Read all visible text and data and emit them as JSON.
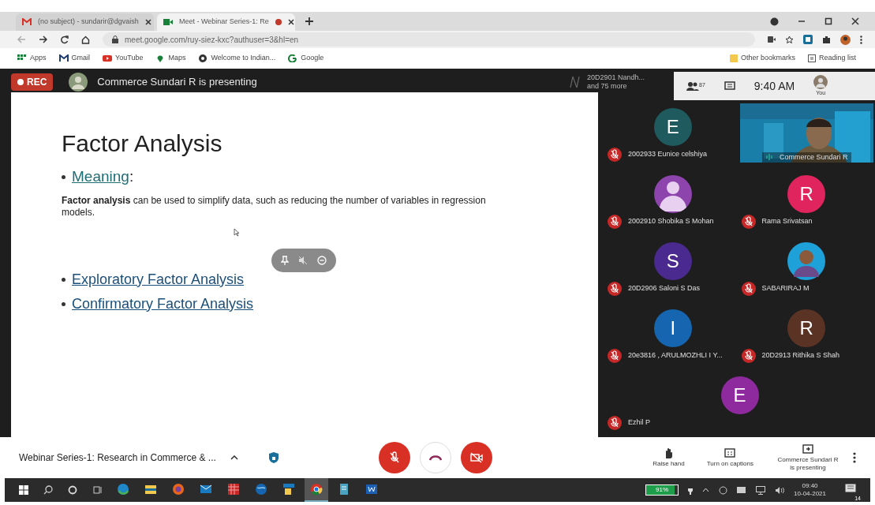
{
  "browser": {
    "tabs": [
      {
        "label": "(no subject) - sundarir@dgvaish",
        "selected": false,
        "recording": false
      },
      {
        "label": "Meet - Webinar Series-1: Re",
        "selected": true,
        "recording": true
      }
    ],
    "url": "meet.google.com/ruy-siez-kxc?authuser=3&hl=en",
    "bookmarks": [
      {
        "label": "Apps",
        "kind": "apps"
      },
      {
        "label": "Gmail",
        "kind": "gmail"
      },
      {
        "label": "YouTube",
        "kind": "youtube"
      },
      {
        "label": "Maps",
        "kind": "maps"
      },
      {
        "label": "Welcome to Indian...",
        "kind": "globe"
      },
      {
        "label": "Google",
        "kind": "google"
      }
    ],
    "bookmarks_right": [
      "Other bookmarks",
      "Reading list"
    ]
  },
  "meet": {
    "rec": "REC",
    "presenting": "Commerce Sundari R is presenting",
    "others": [
      "20D2901 Nandh...",
      "and 75 more"
    ],
    "people_count": "87",
    "time": "9:40 AM",
    "you": "You",
    "slide": {
      "title": "Factor Analysis",
      "meaning_link": "Meaning",
      "meaning_suffix": ":",
      "body": "**Factor analysis** can be used to simplify data, such as reducing the number of variables in regression models.",
      "links": [
        "Exploratory Factor Analysis",
        "Confirmatory Factor Analysis"
      ]
    },
    "participants": [
      {
        "name": "2002933 Eunice celshiya",
        "kind": "letter",
        "letter": "E",
        "color": "#1f5a5e",
        "muted": true
      },
      {
        "name": "Commerce Sundari R",
        "kind": "video",
        "muted": false
      },
      {
        "name": "2002910 Shobika S Mohan",
        "kind": "avatar",
        "color": "#8e44ad",
        "muted": true
      },
      {
        "name": "Rama Srivatsan",
        "kind": "letter",
        "letter": "R",
        "color": "#e0245e",
        "muted": true
      },
      {
        "name": "20D2906 Saloni S Das",
        "kind": "letter",
        "letter": "S",
        "color": "#4a2a8f",
        "muted": true
      },
      {
        "name": "SABARIRAJ M",
        "muted": true
      },
      {
        "name": "20e3816 , ARULMOZHLI I Y...",
        "kind": "letter",
        "letter": "I",
        "color": "#1565b0",
        "muted": true
      },
      {
        "name": "20D2913 Rithika S Shah",
        "kind": "letter",
        "letter": "R",
        "color": "#5a3325",
        "muted": true
      },
      {
        "name": "Ezhil P",
        "kind": "letter",
        "letter": "E",
        "color": "#8e2a9e",
        "muted": true
      }
    ],
    "meeting_title": "Webinar Series-1: Research in Commerce & ...",
    "controls": [
      {
        "label": "Raise hand",
        "kind": "hand"
      },
      {
        "label": "Turn on captions",
        "kind": "captions"
      },
      {
        "label": "Commerce Sundari R is presenting",
        "kind": "present"
      }
    ]
  },
  "taskbar": {
    "apps": [
      {
        "kind": "edge",
        "selected": false
      },
      {
        "kind": "folder",
        "selected": false
      },
      {
        "kind": "firefox",
        "selected": false
      },
      {
        "kind": "mail",
        "selected": false
      },
      {
        "kind": "grid",
        "selected": false
      },
      {
        "kind": "globe",
        "selected": false
      },
      {
        "kind": "tool",
        "selected": false
      },
      {
        "kind": "chrome",
        "selected": true
      },
      {
        "kind": "doc",
        "selected": false
      },
      {
        "kind": "word",
        "selected": false
      }
    ],
    "battery": {
      "text": "91%",
      "level": 0.91
    },
    "time": "09:40",
    "date": "10-04-2021",
    "notifications": "14"
  }
}
